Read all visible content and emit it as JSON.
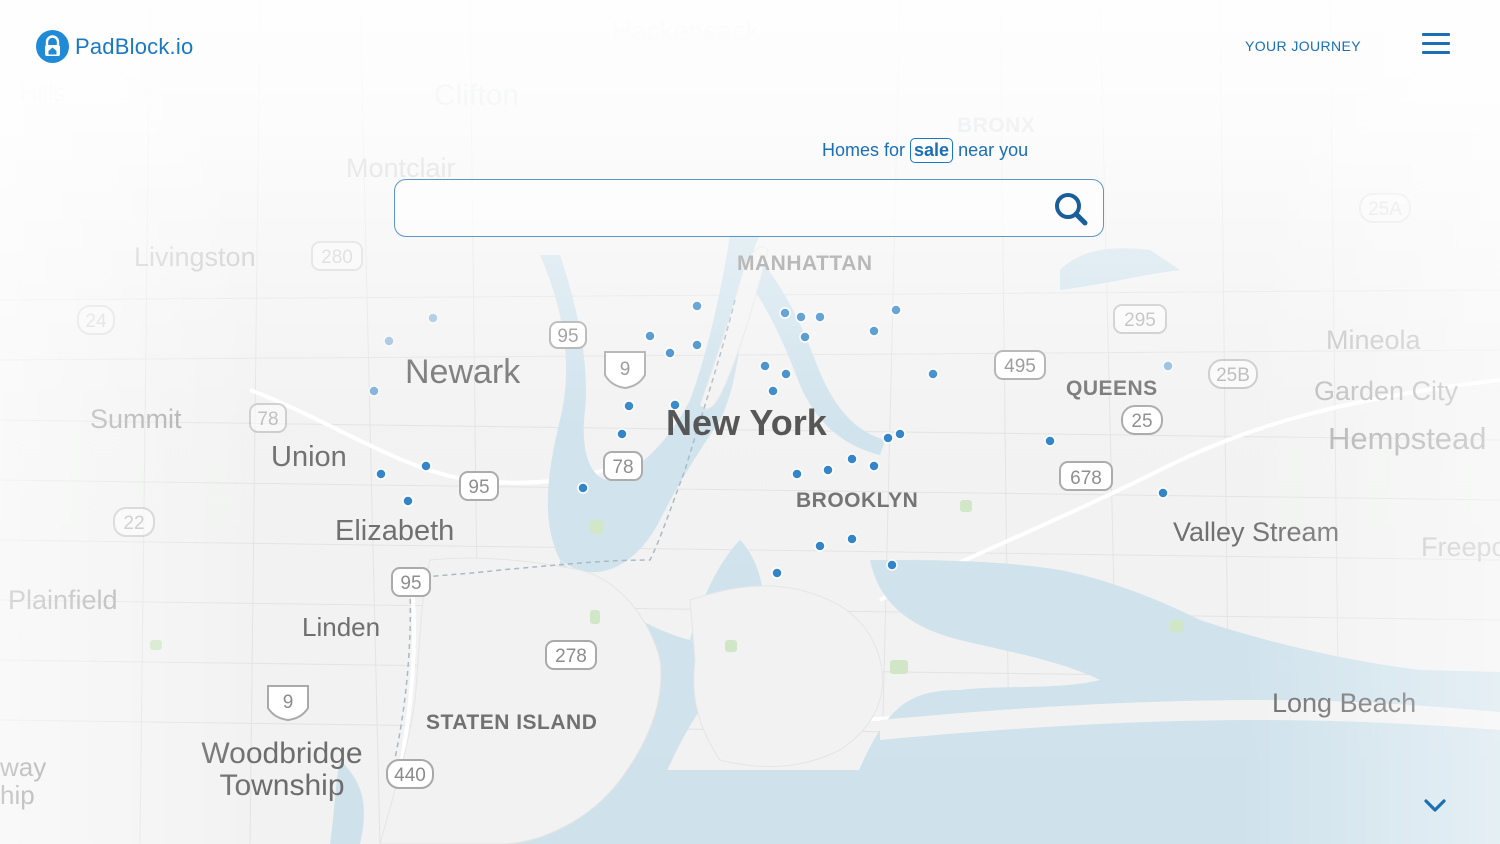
{
  "header": {
    "brand": "PadBlock.io",
    "nav_journey": "YOUR JOURNEY"
  },
  "search": {
    "prefix": "Homes for",
    "mode": "sale",
    "suffix": "near you",
    "value": "",
    "placeholder": ""
  },
  "map": {
    "city_labels": {
      "new_york": "New York",
      "newark": "Newark",
      "union": "Union",
      "elizabeth": "Elizabeth",
      "linden": "Linden",
      "woodbridge": "Woodbridge Township",
      "summit": "Summit",
      "plainfield": "Plainfield",
      "livingston": "Livingston",
      "montclair": "Montclair",
      "clifton": "Clifton",
      "hackensack": "Hackensack",
      "mineola": "Mineola",
      "garden_city": "Garden City",
      "hempstead": "Hempstead",
      "valley_stream": "Valley Stream",
      "long_beach": "Long Beach",
      "freeport": "Freepo",
      "rahway": "way",
      "township": "hip",
      "hills": "Hills"
    },
    "borough_labels": {
      "manhattan": "MANHATTAN",
      "brooklyn": "BROOKLYN",
      "queens": "QUEENS",
      "bronx": "BRONX",
      "staten_island": "STATEN ISLAND"
    },
    "highway_shields": [
      "95",
      "9",
      "78",
      "95",
      "95",
      "278",
      "9",
      "440",
      "78",
      "22",
      "24",
      "280",
      "495",
      "295",
      "25",
      "25B",
      "678",
      "25A"
    ],
    "colors": {
      "water": "#cfe2ec",
      "land": "#f1f2f1",
      "park": "#cfe6c6",
      "marker": "#2a80c5"
    }
  },
  "icons": {
    "search": "search-icon",
    "menu": "hamburger-menu-icon",
    "scroll": "chevron-down-icon",
    "logo": "padlock-house-icon"
  }
}
